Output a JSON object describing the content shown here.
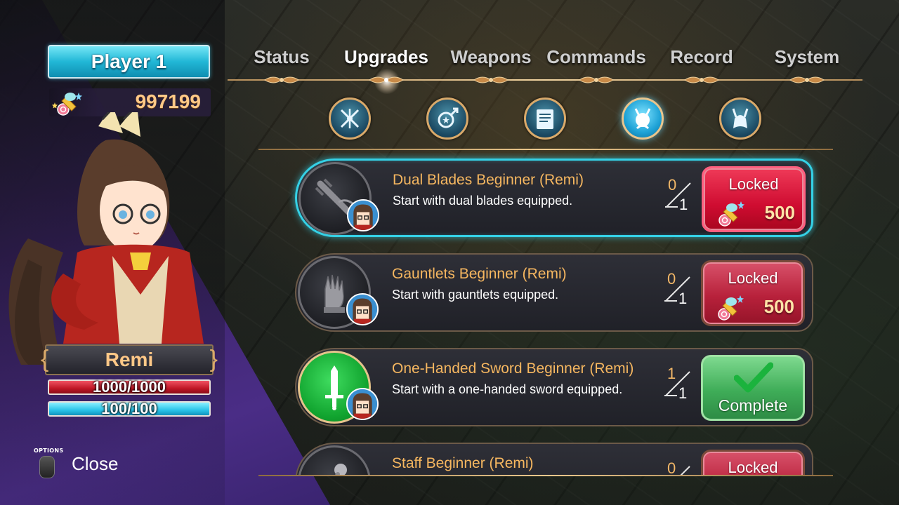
{
  "player": {
    "label": "Player 1",
    "currency": "997199"
  },
  "character": {
    "name": "Remi",
    "hp": "1000/1000",
    "mp": "100/100"
  },
  "close": {
    "options_label": "OPTIONS",
    "label": "Close"
  },
  "tabs": [
    {
      "label": "Status"
    },
    {
      "label": "Upgrades"
    },
    {
      "label": "Weapons"
    },
    {
      "label": "Commands"
    },
    {
      "label": "Record"
    },
    {
      "label": "System"
    }
  ],
  "active_tab": "Upgrades",
  "categories": [
    "weapons-icon",
    "magic-icon",
    "book-icon",
    "remi-icon",
    "spirit-icon"
  ],
  "upgrades": [
    {
      "title": "Dual Blades Beginner (Remi)",
      "desc": "Start with dual blades equipped.",
      "count": "0",
      "total": "1",
      "status": "Locked",
      "price": "500",
      "weapon_icon": "dual-blades-icon"
    },
    {
      "title": "Gauntlets Beginner (Remi)",
      "desc": "Start with gauntlets equipped.",
      "count": "0",
      "total": "1",
      "status": "Locked",
      "price": "500",
      "weapon_icon": "gauntlet-icon"
    },
    {
      "title": "One-Handed Sword Beginner (Remi)",
      "desc": "Start with a one-handed sword equipped.",
      "count": "1",
      "total": "1",
      "status": "Complete",
      "weapon_icon": "sword-icon"
    },
    {
      "title": "Staff Beginner (Remi)",
      "count": "0",
      "status": "Locked",
      "weapon_icon": "staff-icon"
    }
  ],
  "colors": {
    "accent_cyan": "#35d1e6",
    "locked_red": "#cf0c31",
    "complete_green": "#3fad58",
    "gold": "#f6b760"
  }
}
